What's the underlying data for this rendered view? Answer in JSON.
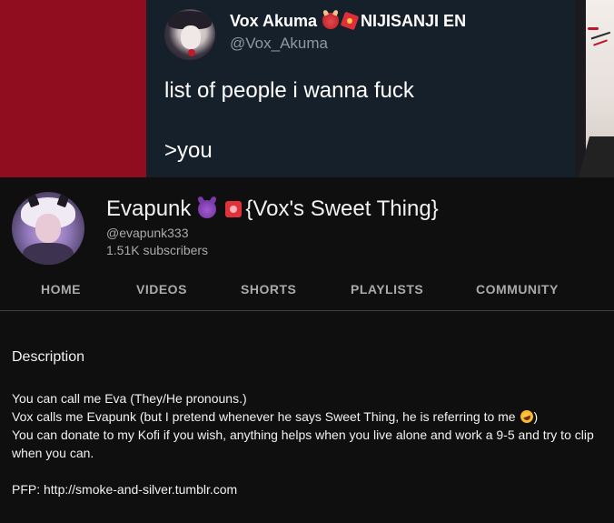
{
  "banner": {
    "tweet": {
      "name": "Vox Akuma",
      "affiliation": "NIJISANJI EN",
      "handle": "@Vox_Akuma",
      "line1": "list of people i wanna fuck",
      "line2": ">you"
    }
  },
  "channel": {
    "name": "Evapunk",
    "name_suffix": "{Vox's Sweet Thing}",
    "handle": "@evapunk333",
    "subscribers": "1.51K subscribers"
  },
  "tabs": [
    {
      "label": "HOME"
    },
    {
      "label": "VIDEOS"
    },
    {
      "label": "SHORTS"
    },
    {
      "label": "PLAYLISTS"
    },
    {
      "label": "COMMUNITY"
    }
  ],
  "description": {
    "heading": "Description",
    "line1": "You can call me Eva (They/He pronouns.)",
    "line2_pre": "Vox calls me Evapunk (but I pretend whenever he says Sweet Thing, he is referring to me",
    "line2_post": ")",
    "line3": "You can donate to my Kofi if you wish, anything helps when you live alone and work a 9-5 and try to clip when you can.",
    "pfp": "PFP: http://smoke-and-silver.tumblr.com"
  },
  "icons": {
    "tweet_emoji_1": "ogre-emoji",
    "tweet_emoji_2": "red-envelope-emoji",
    "name_emoji_1": "smiling-devil-emoji",
    "name_emoji_2": "red-badge-emoji",
    "desc_emoji": "rolling-laughing-emoji"
  },
  "colors": {
    "background": "#0f0f0f",
    "banner_red": "#8f0d1f",
    "tweet_bg": "#16202b",
    "secondary_text": "#aaaaaa"
  }
}
